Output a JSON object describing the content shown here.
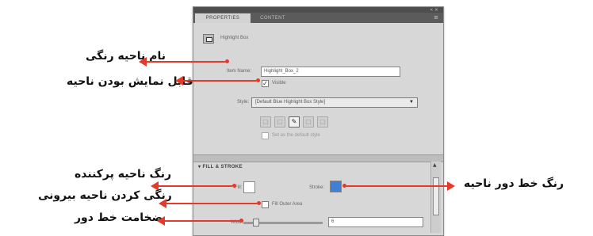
{
  "panel": {
    "tabs": [
      "PROPERTIES",
      "CONTENT"
    ],
    "window_controls": "« ×",
    "header_title": "Highlight Box",
    "item_name_label": "Item Name:",
    "item_name_value": "Highlight_Box_2",
    "visible_label": "Visible",
    "style_label": "Style:",
    "style_value": "[Default Blue Highlight Box Style]",
    "also_apply_label": "Set as the default style",
    "section_title": "FILL & STROKE",
    "fill_label": "Fill:",
    "stroke_label": "Stroke:",
    "fill_outer_label": "Fill Outer Area",
    "width_label": "Width:",
    "width_value": "6",
    "fill_color": "#ffffff",
    "stroke_color": "#3f7fd6"
  },
  "annotations": {
    "item_name": "نام ناحیه رنگی",
    "visible": "قابل نمایش بودن ناحیه",
    "fill": "رنگ ناحیه پرکننده",
    "fill_outer": "رنگی کردن ناحیه بیرونی",
    "width": "ضخامت خط دور",
    "stroke": "رنگ خط دور ناحیه"
  },
  "colors": {
    "arrow": "#e53a2a"
  }
}
